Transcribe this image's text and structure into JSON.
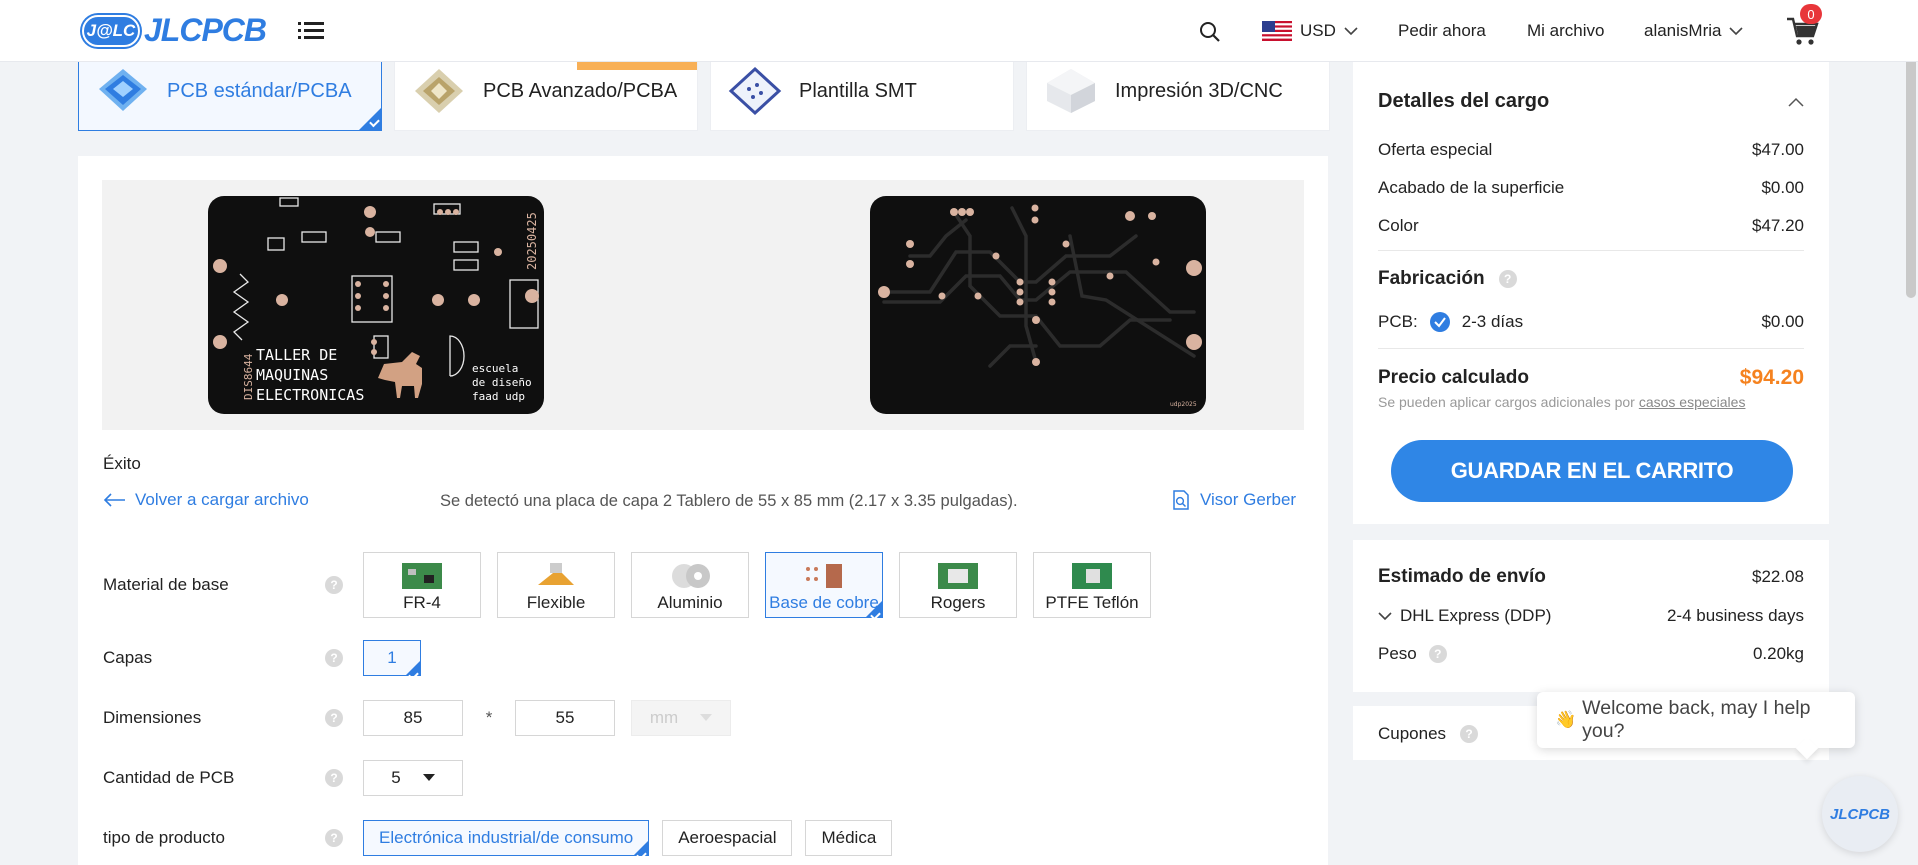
{
  "header": {
    "logo_badge": "J@LC",
    "logo_text": "JLCPCB",
    "currency": "USD",
    "nav": [
      "Pedir ahora",
      "Mi archivo"
    ],
    "user": "alanisMria",
    "cart_count": "0"
  },
  "tabs": [
    {
      "label": "PCB estándar/PCBA",
      "active": true
    },
    {
      "label": "PCB Avanzado/PCBA",
      "active": false
    },
    {
      "label": "Plantilla SMT",
      "active": false
    },
    {
      "label": "Impresión 3D/CNC",
      "active": false
    }
  ],
  "preview": {
    "front_text": {
      "title_lines": [
        "TALLER DE",
        "MAQUINAS",
        "ELECTRONICAS"
      ],
      "school_lines": [
        "escuela",
        "de diseño",
        "faad udp"
      ],
      "code": "DIS8644",
      "date": "20250425"
    },
    "back_text": "udp2025"
  },
  "upload": {
    "status": "Éxito",
    "back_link": "Volver a cargar archivo",
    "detected": "Se detectó una placa de capa 2 Tablero de 55 x 85 mm (2.17 x 3.35 pulgadas).",
    "gerber_link": "Visor Gerber"
  },
  "options": {
    "material": {
      "label": "Material de base",
      "items": [
        "FR-4",
        "Flexible",
        "Aluminio",
        "Base de cobre",
        "Rogers",
        "PTFE Teflón"
      ],
      "selected": "Base de cobre"
    },
    "layers": {
      "label": "Capas",
      "value": "1"
    },
    "dimensions": {
      "label": "Dimensiones",
      "length": "85",
      "width": "55",
      "separator": "*",
      "unit": "mm"
    },
    "quantity": {
      "label": "Cantidad de PCB",
      "value": "5"
    },
    "product_type": {
      "label": "tipo de producto",
      "items": [
        "Electrónica industrial/de consumo",
        "Aeroespacial",
        "Médica"
      ],
      "selected": "Electrónica industrial/de consumo"
    }
  },
  "charges": {
    "title": "Detalles del cargo",
    "lines": [
      {
        "label": "Oferta especial",
        "value": "$47.00"
      },
      {
        "label": "Acabado de la superficie",
        "value": "$0.00"
      },
      {
        "label": "Color",
        "value": "$47.20"
      }
    ],
    "fabrication": {
      "title": "Fabricación",
      "pcb_label": "PCB:",
      "time": "2-3 días",
      "value": "$0.00"
    },
    "total_label": "Precio calculado",
    "total_value": "$94.20",
    "note": "Se pueden aplicar cargos adicionales por",
    "note_link": "casos especiales",
    "cart_button": "GUARDAR EN EL CARRITO",
    "total_color": "#f5821f",
    "accent": "#2f7de1"
  },
  "shipping": {
    "title": "Estimado de envío",
    "cost": "$22.08",
    "method": "DHL Express (DDP)",
    "days": "2-4 business days",
    "weight_label": "Peso",
    "weight": "0.20kg"
  },
  "coupons": {
    "label": "Cupones"
  },
  "chat": {
    "message": "Welcome back, may I help you?",
    "bubble": "JLCPCB",
    "emoji": "👋"
  }
}
